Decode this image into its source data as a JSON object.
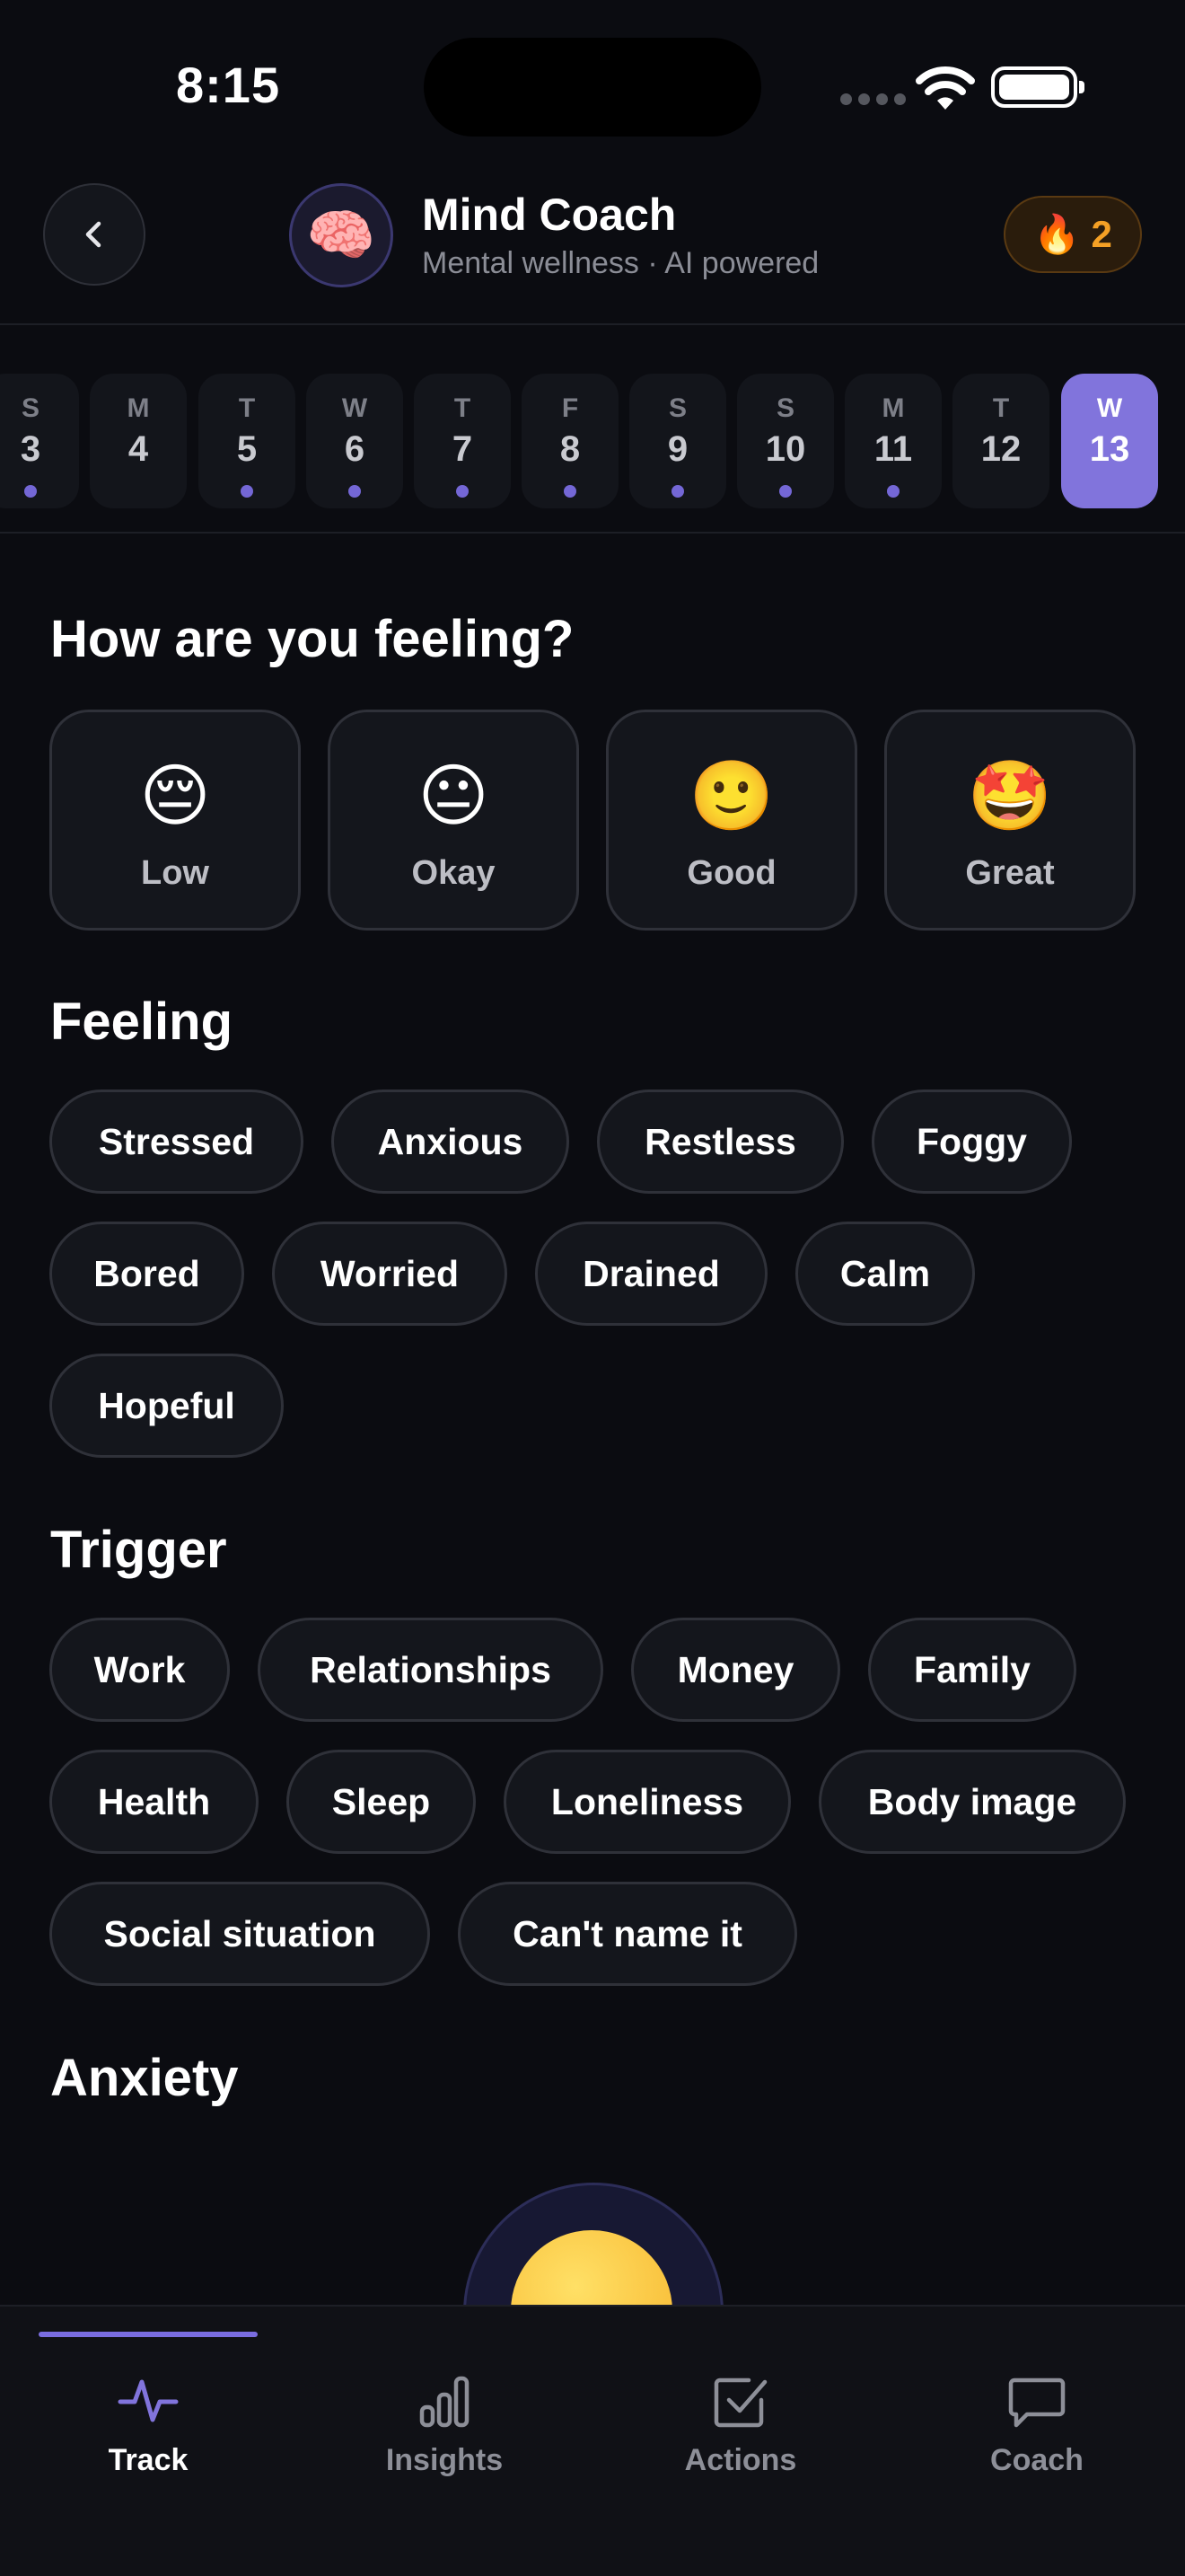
{
  "status_bar": {
    "time": "8:15"
  },
  "header": {
    "back_icon": "chevron-left-icon",
    "avatar_emoji": "🧠",
    "title": "Mind Coach",
    "subtitle": "Mental wellness · AI powered",
    "streak_icon": "🔥",
    "streak_count": "2"
  },
  "date_strip": {
    "days": [
      {
        "dow": "S",
        "num": "3",
        "has_entry": true
      },
      {
        "dow": "M",
        "num": "4",
        "has_entry": false
      },
      {
        "dow": "T",
        "num": "5",
        "has_entry": true
      },
      {
        "dow": "W",
        "num": "6",
        "has_entry": true
      },
      {
        "dow": "T",
        "num": "7",
        "has_entry": true
      },
      {
        "dow": "F",
        "num": "8",
        "has_entry": true
      },
      {
        "dow": "S",
        "num": "9",
        "has_entry": true
      },
      {
        "dow": "S",
        "num": "10",
        "has_entry": true
      },
      {
        "dow": "M",
        "num": "11",
        "has_entry": true
      },
      {
        "dow": "T",
        "num": "12",
        "has_entry": false
      },
      {
        "dow": "W",
        "num": "13",
        "has_entry": false,
        "selected": true
      }
    ]
  },
  "mood": {
    "title": "How are you feeling?",
    "options": [
      {
        "emoji": "😔",
        "label": "Low"
      },
      {
        "emoji": "😐",
        "label": "Okay"
      },
      {
        "emoji": "🙂",
        "label": "Good"
      },
      {
        "emoji": "🤩",
        "label": "Great"
      }
    ]
  },
  "feeling": {
    "title": "Feeling",
    "chips": [
      "Stressed",
      "Anxious",
      "Restless",
      "Foggy",
      "Bored",
      "Worried",
      "Drained",
      "Calm",
      "Hopeful"
    ]
  },
  "trigger": {
    "title": "Trigger",
    "chips": [
      "Work",
      "Relationships",
      "Money",
      "Family",
      "Health",
      "Sleep",
      "Loneliness",
      "Body image",
      "Social situation",
      "Can't name it"
    ]
  },
  "anxiety": {
    "title": "Anxiety"
  },
  "tab_bar": {
    "tabs": [
      {
        "label": "Track",
        "icon": "activity-pulse-icon",
        "active": true
      },
      {
        "label": "Insights",
        "icon": "bar-chart-icon",
        "active": false
      },
      {
        "label": "Actions",
        "icon": "checkbox-icon",
        "active": false
      },
      {
        "label": "Coach",
        "icon": "chat-bubble-icon",
        "active": false
      }
    ]
  },
  "colors": {
    "background": "#0b0c11",
    "accent": "#8174dc",
    "streak": "#f4a025",
    "card": "#14161c"
  }
}
